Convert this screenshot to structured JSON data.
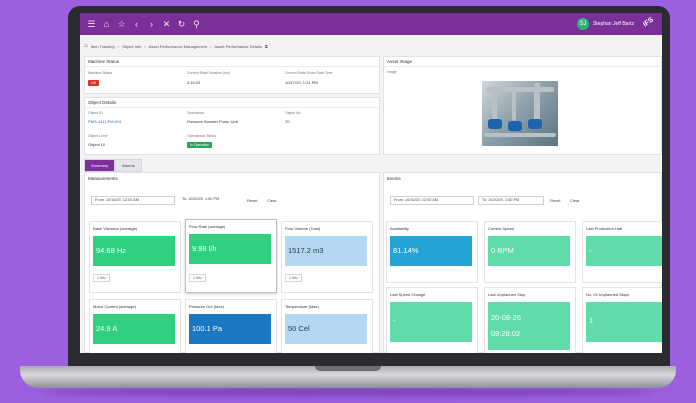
{
  "topbar": {
    "icons": [
      "menu-icon",
      "home-icon",
      "star-icon",
      "back-icon",
      "forward-icon",
      "close-icon",
      "refresh-icon",
      "search-icon"
    ],
    "user_initials": "SJ",
    "user_name": "Stephan Jeff Bartz",
    "logo": "IFS"
  },
  "breadcrumb": [
    "Item Tracking",
    "Object Info",
    "Asset Performance Management",
    "Asset Performance Details"
  ],
  "machine_status": {
    "title": "Machine Status",
    "status_label": "Machine Status",
    "status_value": "Off",
    "duration_label": "Current State Duration (hrs)",
    "duration_value": "2:10:23",
    "since_label": "Current State Since Date Time",
    "since_value": "10/17/20, 1:21 PM"
  },
  "object_details": {
    "title": "Object Details",
    "object_id_label": "Object ID",
    "object_id_value": "PMS-4111-PM-001",
    "description_label": "Description",
    "description_value": "Pressure Booster Pump Unit",
    "object_no_label": "Object No",
    "object_no_value": "70",
    "object_level_label": "Object Level",
    "object_level_value": "Object 10",
    "operational_status_label": "Operational Status",
    "operational_status_value": "In Operation"
  },
  "asset_image": {
    "title": "Asset Image",
    "image_label": "Image"
  },
  "tabs": [
    "Summary",
    "Alarms"
  ],
  "measurements": {
    "title": "Measurements",
    "from": "From: 10/16/20, 12:00 AM",
    "to": "To: 10/20/20, 1:50 PM",
    "reset": "Reset",
    "clear": "Clear",
    "cards": [
      {
        "title": "Base Vibration (average)",
        "value": "94.68 Hz",
        "unit": "1 Sec"
      },
      {
        "title": "Flow Rate (average)",
        "value": "9.98 l/h",
        "unit": "1 Sec"
      },
      {
        "title": "Flow Volume (Total)",
        "value": "1517.2 m3",
        "unit": "1 Sec"
      },
      {
        "title": "Motor Current (average)",
        "value": "24.9 A"
      },
      {
        "title": "Pressure Out (Max)",
        "value": "100.1 Pa"
      },
      {
        "title": "Temperature (Max)",
        "value": "50 Cel"
      }
    ]
  },
  "events": {
    "title": "Events",
    "from": "From: 10/16/20, 12:00 AM",
    "to": "To: 10/20/20, 1:50 PM",
    "reset": "Reset",
    "clear": "Clear",
    "cards": [
      {
        "title": "Availability",
        "value": "81.14%"
      },
      {
        "title": "Current Speed",
        "value": "0 RPM"
      },
      {
        "title": "Last Production Halt",
        "value": "-"
      },
      {
        "title": "Last Speed Change",
        "value": "-"
      },
      {
        "title": "Last Unplanned Stop",
        "value": "20-08-26",
        "value2": "09:28:02"
      },
      {
        "title": "No. Of Unplanned Stops",
        "value": "1"
      }
    ]
  },
  "colors": {
    "green": "#2fd080",
    "blue": "#1a78c2",
    "light_blue": "#b5d8f2",
    "teal": "#5fdcaa",
    "sky": "#25a5d6",
    "purple": "#7b2f98"
  }
}
